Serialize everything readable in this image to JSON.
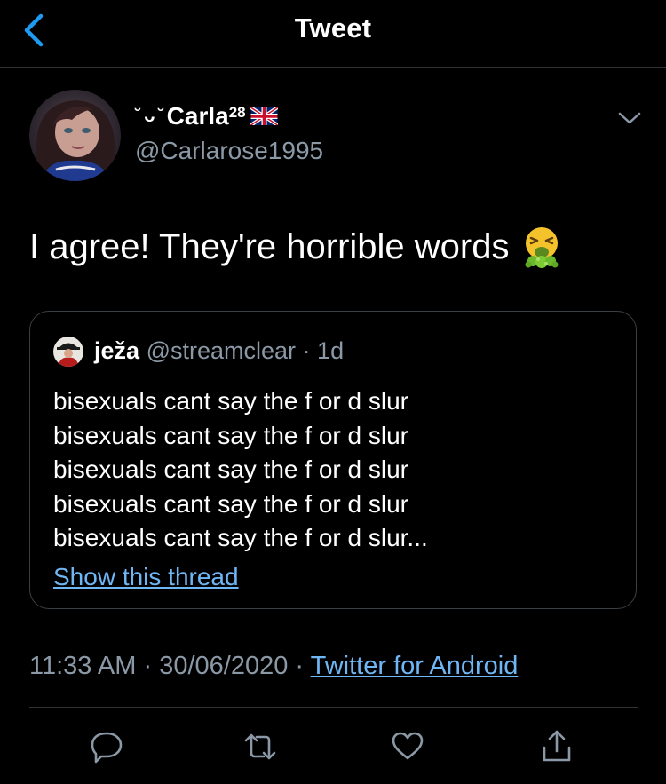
{
  "header": {
    "title": "Tweet",
    "back_icon": "chevron-left-icon"
  },
  "tweet": {
    "author": {
      "face_glyph": "˘ ᴗ ˘",
      "name": "Carla",
      "superscript": "28",
      "flag_icon": "uk-flag-icon",
      "handle": "@Carlarose1995"
    },
    "text": "I agree! They're horrible words",
    "emoji_icon": "vomiting-face-icon",
    "quoted": {
      "name": "ježa",
      "handle": "@streamclear",
      "separator": "·",
      "time": "1d",
      "lines": [
        "bisexuals cant say the f or d slur",
        "bisexuals cant say the f or d slur",
        "bisexuals cant say the f or d slur",
        "bisexuals cant say the f or d slur",
        "bisexuals cant say the f or d slur..."
      ],
      "show_thread": "Show this thread"
    },
    "time": "11:33 AM",
    "date": "30/06/2020",
    "separator": "·",
    "source": "Twitter for Android"
  },
  "actions": [
    {
      "name": "reply",
      "icon": "reply-icon"
    },
    {
      "name": "retweet",
      "icon": "retweet-icon"
    },
    {
      "name": "like",
      "icon": "heart-icon"
    },
    {
      "name": "share",
      "icon": "share-icon"
    }
  ],
  "colors": {
    "background": "#000000",
    "accent": "#6fb6f5",
    "secondary_text": "#8b98a5",
    "border": "#2f3336"
  }
}
